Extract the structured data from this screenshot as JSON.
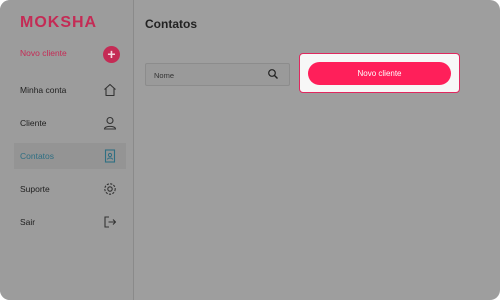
{
  "sidebar": {
    "logo": "MOKSHA",
    "new_client_label": "Novo cliente",
    "items": [
      {
        "label": "Minha conta",
        "icon": "home-icon"
      },
      {
        "label": "Cliente",
        "icon": "user-icon"
      },
      {
        "label": "Contatos",
        "icon": "contact-book-icon",
        "active": true
      },
      {
        "label": "Suporte",
        "icon": "gear-icon"
      },
      {
        "label": "Sair",
        "icon": "logout-icon"
      }
    ]
  },
  "main": {
    "title": "Contatos",
    "search": {
      "placeholder": "Nome",
      "value": ""
    },
    "new_client_button": "Novo cliente"
  },
  "colors": {
    "brand": "#c42b55",
    "accent": "#ff1f5a",
    "active_nav": "#2f6f83",
    "overlay": "#9e9e9e"
  }
}
